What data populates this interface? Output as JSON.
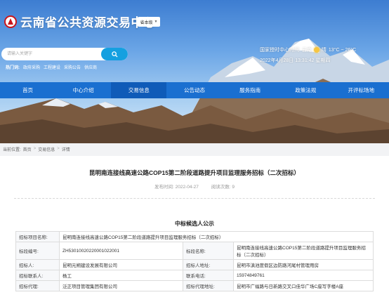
{
  "site": {
    "title": "云南省公共资源交易中心",
    "region_select": "省本级",
    "logo_icon": "yunnan-logo-icon"
  },
  "search": {
    "placeholder": "请输入关键字",
    "hotwords_label": "热门词:",
    "hotwords": [
      "政府采购",
      "工程建设",
      "采购公告",
      "供应商"
    ]
  },
  "weather": {
    "line1": "国家授时中心时间: 云南",
    "condition": "晴",
    "temp": "13°C ~ 26°C",
    "datetime": "2022年4月28日 13:31:42 星期四"
  },
  "nav": {
    "items": [
      {
        "label": "首页"
      },
      {
        "label": "中心介绍"
      },
      {
        "label": "交易信息"
      },
      {
        "label": "公告动态"
      },
      {
        "label": "服务指南"
      },
      {
        "label": "政策法规"
      },
      {
        "label": "开评标场地"
      }
    ],
    "active_index": 2
  },
  "breadcrumb": {
    "prefix": "当前位置:",
    "items": [
      "首页",
      "交易信息",
      "详情"
    ],
    "sep": ">"
  },
  "article": {
    "title": "昆明南连接线高速公路COP15第二阶段道路提升项目监理服务招标（二次招标）",
    "publish_label": "发布时间: 2022-04-27",
    "views_label": "阅读次数: 9",
    "section_title": "中标候选人公示"
  },
  "table": {
    "rows": [
      {
        "cells": [
          {
            "label": "招标项目名称:",
            "value": "昆明南连接线高速公路COP15第二阶段道路提升项目监理服务招标（二次招标）",
            "span": 3
          }
        ]
      },
      {
        "cells": [
          {
            "label": "标段编号:",
            "value": "ZH53010020220001022001"
          },
          {
            "label": "标段名称:",
            "value": "昆明南连接线高速公路COP15第二阶段道路提升项目监理服务招标（二次招标）"
          }
        ]
      },
      {
        "cells": [
          {
            "label": "招标人:",
            "value": "昆明元朔建设发展有限公司"
          },
          {
            "label": "招标人地址:",
            "value": "昆明市滇池度假区边防路河尾村管理用房"
          }
        ]
      },
      {
        "cells": [
          {
            "label": "招标联系人:",
            "value": "杨工"
          },
          {
            "label": "联系电话:",
            "value": "15974849761"
          }
        ]
      },
      {
        "cells": [
          {
            "label": "招标代理:",
            "value": "泛正项目管理集团有限公司"
          },
          {
            "label": "招标代理地址:",
            "value": "昆明市广福路与日新路交叉口佳华广场C座写字楼A座"
          }
        ]
      }
    ]
  },
  "colors": {
    "nav": "#1a6fd0",
    "nav_active": "#0f5bb8",
    "search_button": "#15a0e0",
    "logo_red": "#c8161d"
  }
}
